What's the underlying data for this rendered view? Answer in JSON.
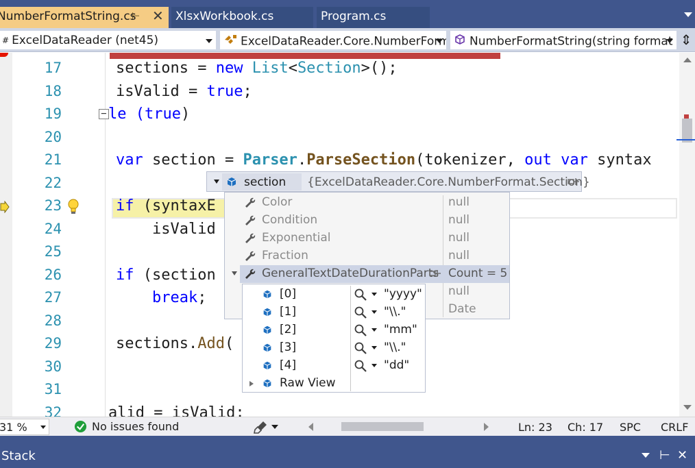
{
  "tabs": [
    {
      "label": "NumberFormatString.cs",
      "active": true,
      "pinned": true
    },
    {
      "label": "XlsxWorkbook.cs",
      "active": false
    },
    {
      "label": "Program.cs",
      "active": false
    }
  ],
  "navbar": {
    "project": "ExcelDataReader (net45)",
    "type": "ExcelDataReader.Core.NumberForm",
    "member": "NumberFormatString(string format"
  },
  "editor": {
    "line_numbers": [
      "17",
      "18",
      "19",
      "20",
      "21",
      "22",
      "23",
      "24",
      "25",
      "26",
      "27",
      "28",
      "29",
      "30",
      "31",
      "32"
    ],
    "current_line": "23",
    "code": {
      "l17": [
        "sections = ",
        "new",
        " ",
        "List",
        "<",
        "Section",
        ">();"
      ],
      "l18": [
        "isValid = ",
        "true",
        ";"
      ],
      "l19": [
        "le (",
        "true",
        ")"
      ],
      "l21": [
        "var",
        " section = ",
        "Parser",
        ".",
        "ParseSection",
        "(tokenizer, ",
        "out",
        " ",
        "var",
        " syntax"
      ],
      "l23": [
        "if",
        " (syntaxE"
      ],
      "l24": [
        "    isValid"
      ],
      "l26": [
        "if",
        " (section"
      ],
      "l27": [
        "    ",
        "break",
        ";"
      ],
      "l29": [
        "sections.",
        "Add",
        "("
      ],
      "l32": [
        "alid = isValid;"
      ]
    }
  },
  "datatip": {
    "header": {
      "name": "section",
      "value": "{ExcelDataReader.Core.NumberFormat.Section}"
    },
    "properties": [
      {
        "name": "Color",
        "value": "null"
      },
      {
        "name": "Condition",
        "value": "null"
      },
      {
        "name": "Exponential",
        "value": "null"
      },
      {
        "name": "Fraction",
        "value": "null"
      },
      {
        "name": "GeneralTextDateDurationParts",
        "value": "Count = 5"
      },
      {
        "name": "",
        "value": "null"
      },
      {
        "name": "",
        "value": "Date"
      }
    ],
    "items": [
      {
        "index": "[0]",
        "value": "\"yyyy\""
      },
      {
        "index": "[1]",
        "value": "\"\\\\.\""
      },
      {
        "index": "[2]",
        "value": "\"mm\""
      },
      {
        "index": "[3]",
        "value": "\"\\\\.\""
      },
      {
        "index": "[4]",
        "value": "\"dd\""
      }
    ],
    "raw_view": "Raw View"
  },
  "statusbar": {
    "zoom": "31 %",
    "issues": "No issues found",
    "line": "Ln: 23",
    "column": "Ch: 17",
    "spacing": "SPC",
    "line_ending": "CRLF"
  },
  "bottom_panel": {
    "title": "Stack"
  },
  "colors": {
    "tab_strip": "#40568d",
    "active_tab": "#f5cc84",
    "keyword": "#0000ff",
    "type": "#2b91af",
    "method": "#74531f",
    "line_number": "#2b91af",
    "breakpoint": "#e51400"
  },
  "icons": {
    "tab_pin": "pin-icon",
    "tab_close": "close-icon",
    "property": "wrench-icon",
    "object": "cube-icon",
    "visualizer": "magnifier-icon",
    "lightbulb": "lightbulb-icon",
    "status_ok": "check-circle-icon",
    "cleanup": "brush-icon"
  }
}
